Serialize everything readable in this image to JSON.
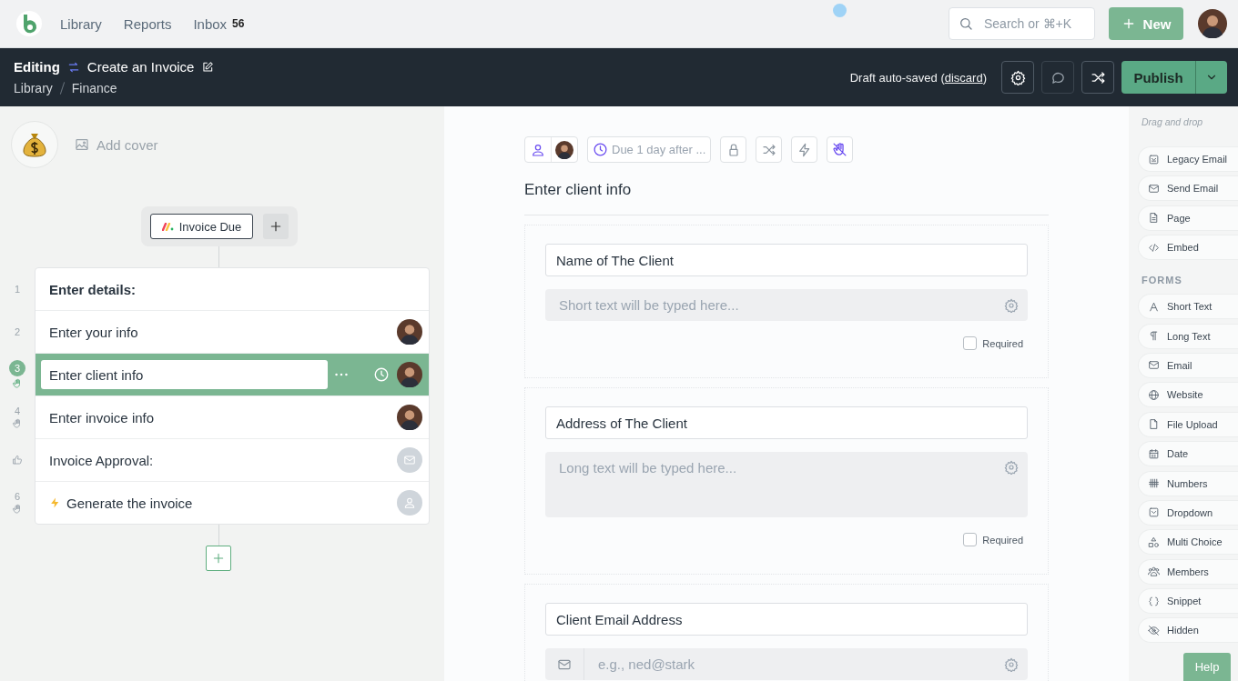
{
  "topbar": {
    "nav": [
      {
        "label": "Library"
      },
      {
        "label": "Reports"
      },
      {
        "label": "Inbox",
        "count": "56"
      }
    ],
    "search": {
      "placeholder": "Search or ⌘+K"
    },
    "new_button": "New"
  },
  "header": {
    "mode": "Editing",
    "title": "Create an Invoice",
    "breadcrumbs": [
      "Library",
      "Finance"
    ],
    "draft_before": "Draft auto-saved (",
    "discard_link": "discard",
    "draft_after": ")",
    "publish_button": "Publish"
  },
  "template": {
    "add_cover": "Add cover",
    "trigger": "Invoice Due"
  },
  "steps": [
    {
      "number": "1",
      "title": "Enter details:",
      "kind": "heading",
      "selected": false,
      "stop": false
    },
    {
      "number": "2",
      "title": "Enter your info",
      "kind": "task",
      "selected": false,
      "stop": false,
      "assignee": {
        "kind": "photo"
      }
    },
    {
      "number": "3",
      "title": "Enter client info",
      "kind": "task",
      "selected": true,
      "stop": true,
      "assignee": {
        "kind": "photo"
      }
    },
    {
      "number": "4",
      "title": "Enter invoice info",
      "kind": "task",
      "selected": false,
      "stop": true,
      "assignee": {
        "kind": "photo"
      }
    },
    {
      "title": "Invoice Approval:",
      "kind": "approval",
      "selected": false,
      "stop": false,
      "assignee": {
        "kind": "email"
      }
    },
    {
      "number": "6",
      "title": "Generate the invoice",
      "kind": "automated",
      "selected": false,
      "stop": true,
      "assignee": {
        "kind": "person"
      }
    }
  ],
  "detail": {
    "due": "Due 1 day after ...",
    "title": "Enter client info",
    "widgets": [
      {
        "kind": "short_text",
        "label": "Name of The Client",
        "placeholder": "Short text will be typed here...",
        "required": false,
        "required_label": "Required"
      },
      {
        "kind": "long_text",
        "label": "Address of The Client",
        "placeholder": "Long text will be typed here...",
        "required": false,
        "required_label": "Required"
      },
      {
        "kind": "email",
        "label": "Client Email Address",
        "placeholder": "e.g., ned@stark"
      }
    ]
  },
  "palette": {
    "hint": "Drag and drop",
    "groups": [
      {
        "items": [
          {
            "kind": "legacy_email",
            "label": "Legacy Email"
          },
          {
            "kind": "send_email",
            "label": "Send Email"
          },
          {
            "kind": "page",
            "label": "Page"
          },
          {
            "kind": "embed",
            "label": "Embed"
          }
        ]
      },
      {
        "heading": "FORMS",
        "items": [
          {
            "kind": "short_text",
            "label": "Short Text"
          },
          {
            "kind": "long_text",
            "label": "Long Text"
          },
          {
            "kind": "email",
            "label": "Email"
          },
          {
            "kind": "website",
            "label": "Website"
          },
          {
            "kind": "file_upload",
            "label": "File Upload"
          },
          {
            "kind": "date",
            "label": "Date"
          },
          {
            "kind": "numbers",
            "label": "Numbers"
          },
          {
            "kind": "dropdown",
            "label": "Dropdown"
          },
          {
            "kind": "multi_choice",
            "label": "Multi Choice"
          },
          {
            "kind": "members",
            "label": "Members"
          },
          {
            "kind": "snippet",
            "label": "Snippet"
          },
          {
            "kind": "hidden",
            "label": "Hidden"
          }
        ]
      }
    ]
  },
  "help_button": "Help"
}
